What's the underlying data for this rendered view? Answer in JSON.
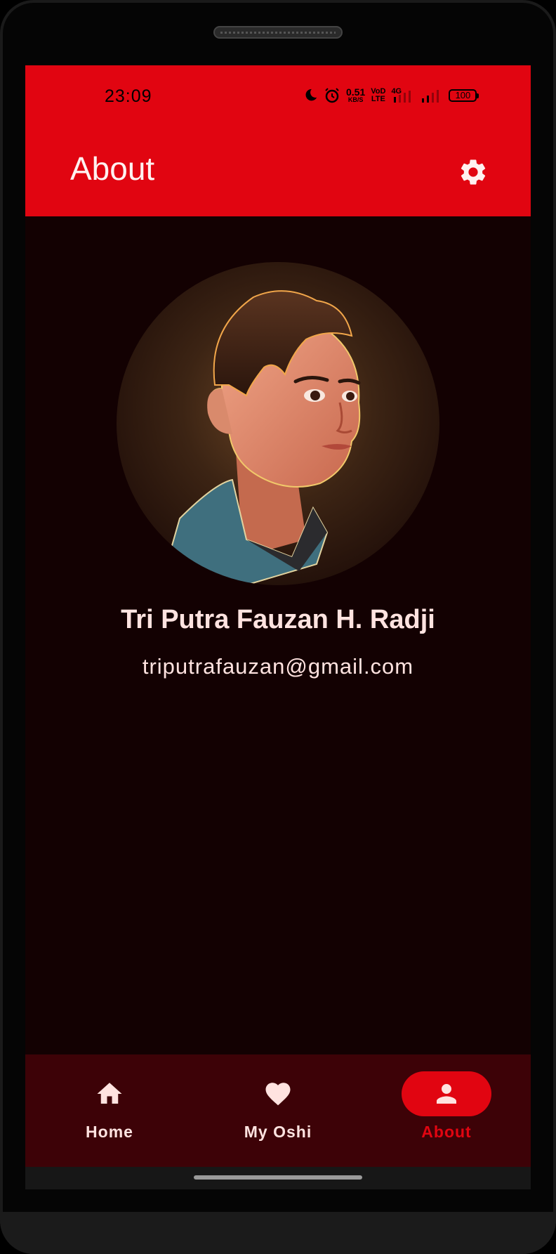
{
  "status_bar": {
    "time": "23:09",
    "net_speed": "0.51",
    "net_unit": "KB/S",
    "volte_top": "VoD",
    "volte_bottom": "LTE",
    "network": "4G",
    "battery": "100"
  },
  "app_bar": {
    "title": "About",
    "settings_icon": "gear-icon"
  },
  "profile": {
    "avatar_icon": "avatar-illustration",
    "name": "Tri Putra Fauzan H. Radji",
    "email": "triputrafauzan@gmail.com"
  },
  "bottom_nav": {
    "items": [
      {
        "label": "Home",
        "icon": "home-icon",
        "active": false
      },
      {
        "label": "My Oshi",
        "icon": "heart-icon",
        "active": false
      },
      {
        "label": "About",
        "icon": "person-icon",
        "active": true
      }
    ]
  },
  "colors": {
    "primary": "#e10511",
    "background": "#130102",
    "nav_background": "#3d0207",
    "text_light": "#ffe3e0"
  }
}
